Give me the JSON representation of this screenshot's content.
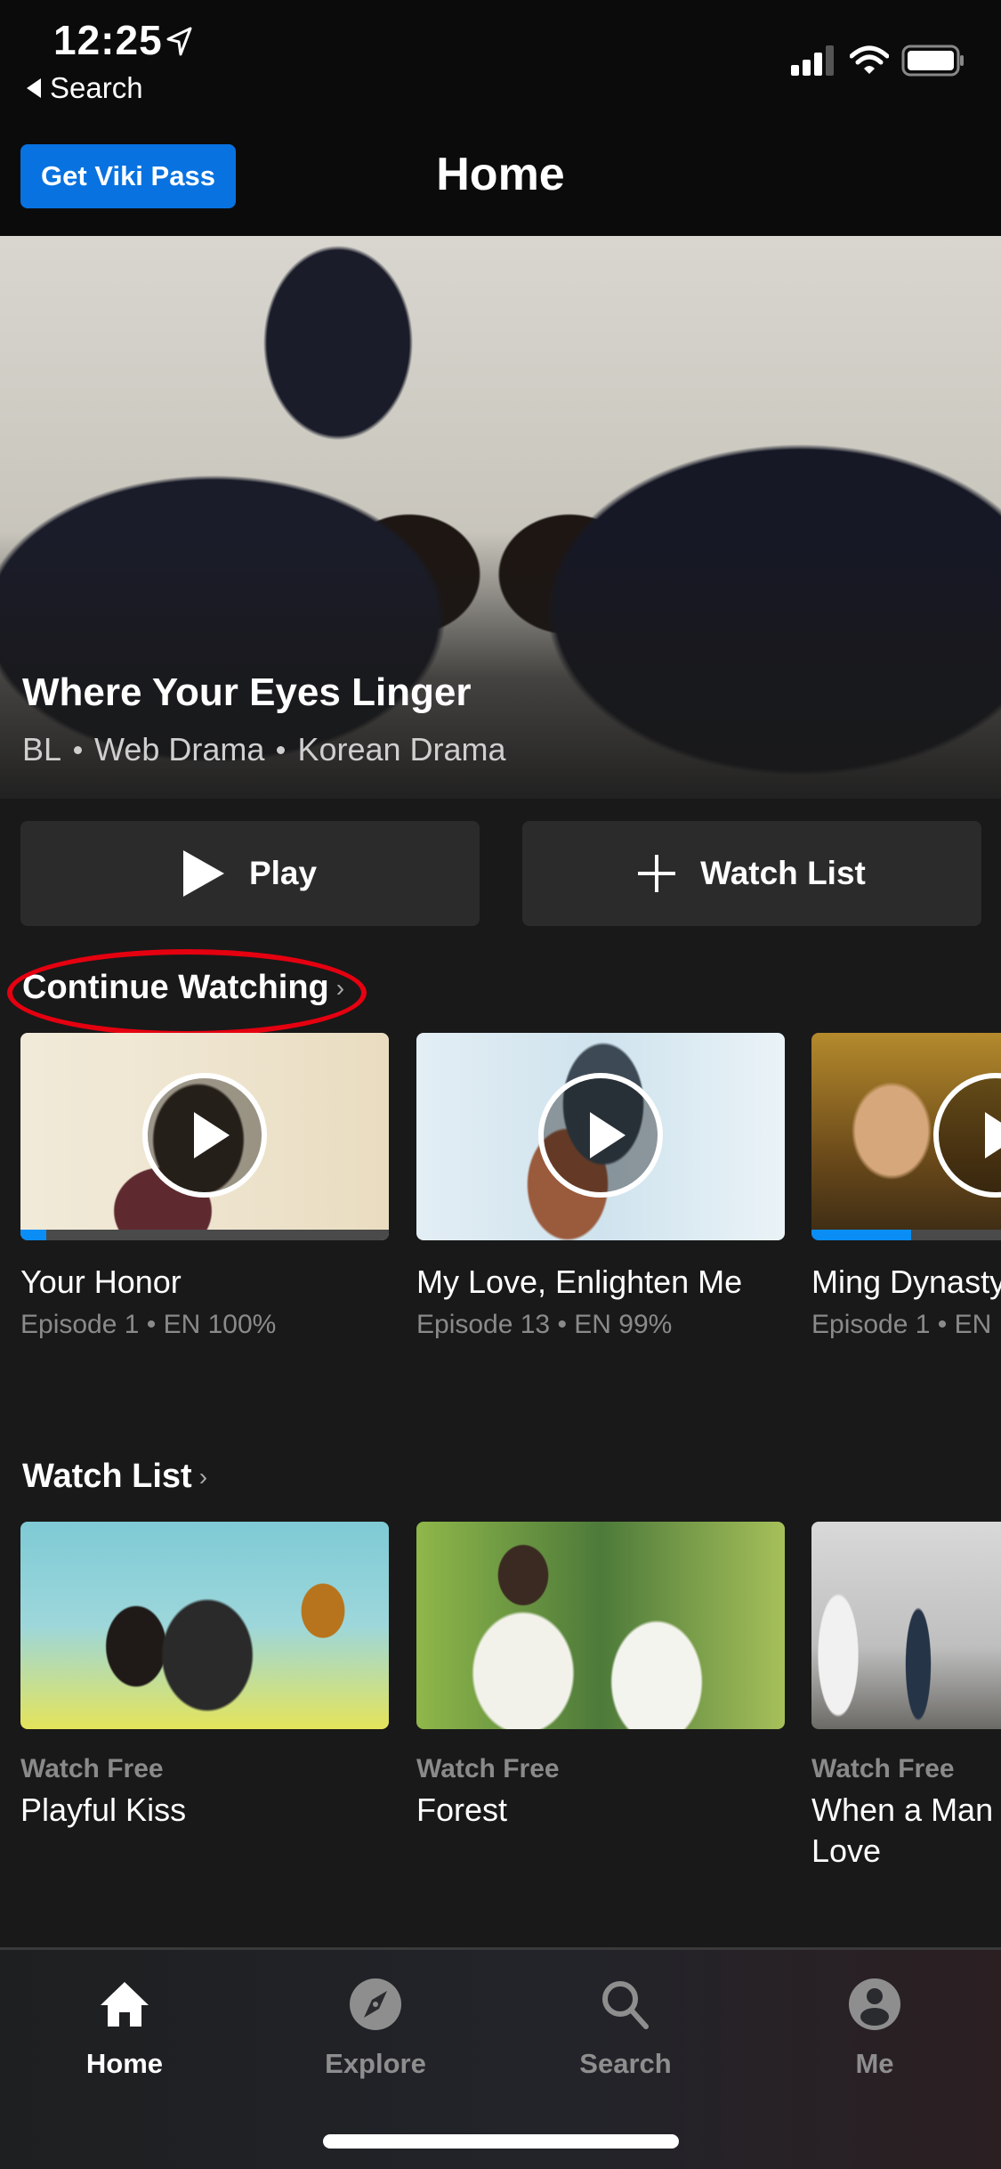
{
  "status_bar": {
    "time": "12:25",
    "back_label": "Search",
    "icons": [
      "location-arrow-icon",
      "signal-icon",
      "wifi-icon",
      "battery-icon"
    ]
  },
  "header": {
    "promo_button": "Get Viki Pass",
    "title": "Home"
  },
  "hero": {
    "title": "Where Your Eyes Linger",
    "genres": [
      "BL",
      "Web Drama",
      "Korean Drama"
    ],
    "play_label": "Play",
    "watchlist_label": "Watch List"
  },
  "continue_watching": {
    "heading": "Continue Watching",
    "chevron": "›",
    "items": [
      {
        "title": "Your Honor",
        "subtitle": "Episode 1 • EN 100%",
        "progress": 0.07
      },
      {
        "title": "My Love, Enlighten Me",
        "subtitle": "Episode 13 • EN 99%",
        "progress": null
      },
      {
        "title": "Ming Dynasty",
        "subtitle": "Episode 1 • EN",
        "progress": 0.27
      }
    ]
  },
  "watch_list": {
    "heading": "Watch List",
    "chevron": "›",
    "items": [
      {
        "badge": "Watch Free",
        "title": "Playful Kiss"
      },
      {
        "badge": "Watch Free",
        "title": "Forest"
      },
      {
        "badge": "Watch Free",
        "title": "When a Man in Love"
      }
    ]
  },
  "tab_bar": {
    "tabs": [
      {
        "label": "Home",
        "icon": "home-icon",
        "active": true
      },
      {
        "label": "Explore",
        "icon": "compass-icon",
        "active": false
      },
      {
        "label": "Search",
        "icon": "search-icon",
        "active": false
      },
      {
        "label": "Me",
        "icon": "profile-icon",
        "active": false
      }
    ]
  },
  "colors": {
    "accent": "#0872e0",
    "progress": "#0a8ef5",
    "annotation": "#e50010",
    "active_tab": "#ffffff",
    "inactive_tab": "#8e8e8e"
  }
}
